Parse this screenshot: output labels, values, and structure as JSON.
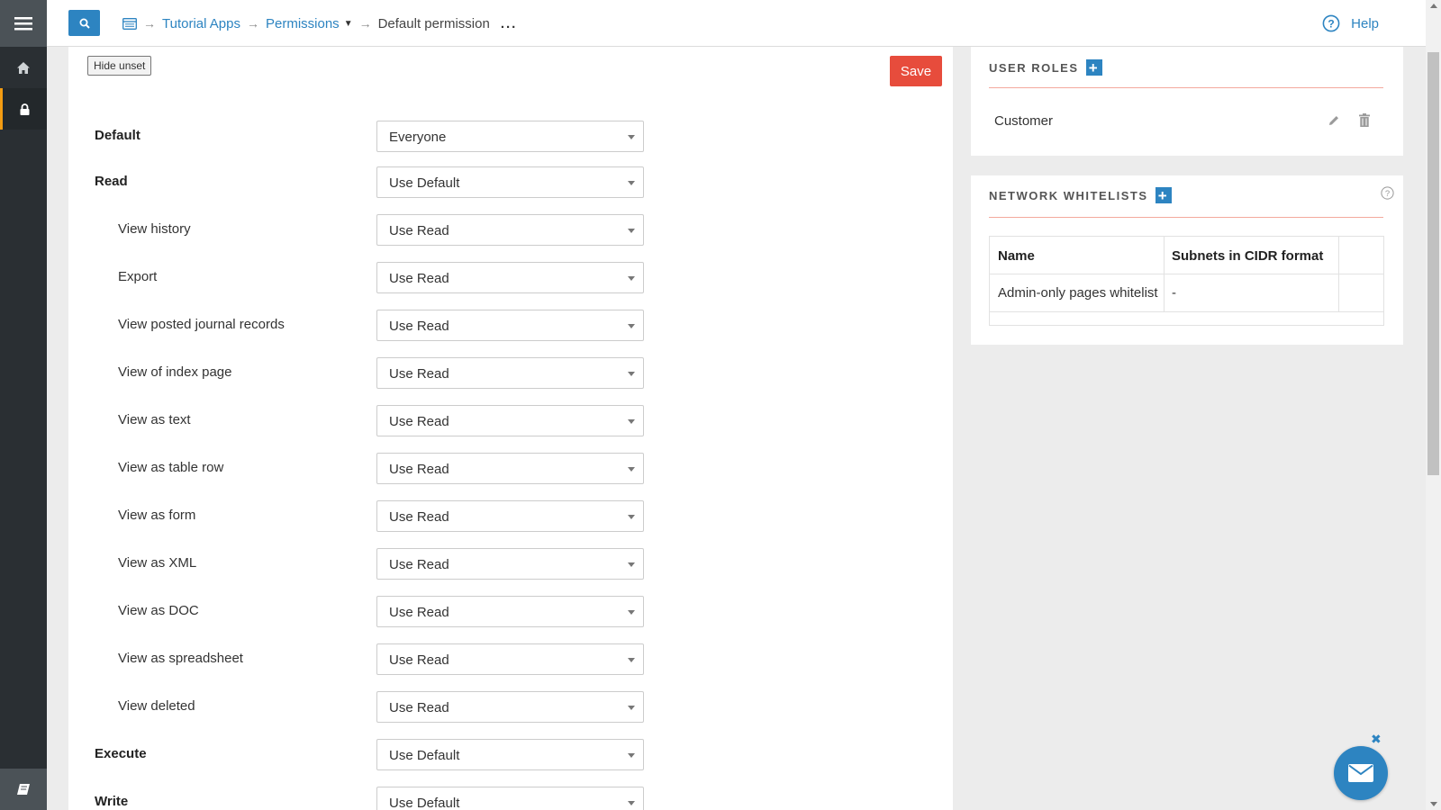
{
  "topbar": {
    "breadcrumb": {
      "crumb1": "Tutorial Apps",
      "crumb2": "Permissions",
      "crumb3": "Default permission",
      "more": "..."
    },
    "help_label": "Help"
  },
  "main": {
    "hide_unset_label": "Hide unset",
    "save_label": "Save",
    "permissions": [
      {
        "label": "Default",
        "value": "Everyone"
      },
      {
        "label": "Read",
        "value": "Use Default"
      },
      {
        "label": "View history",
        "value": "Use Read"
      },
      {
        "label": "Export",
        "value": "Use Read"
      },
      {
        "label": "View posted journal records",
        "value": "Use Read"
      },
      {
        "label": "View of index page",
        "value": "Use Read"
      },
      {
        "label": "View as text",
        "value": "Use Read"
      },
      {
        "label": "View as table row",
        "value": "Use Read"
      },
      {
        "label": "View as form",
        "value": "Use Read"
      },
      {
        "label": "View as XML",
        "value": "Use Read"
      },
      {
        "label": "View as DOC",
        "value": "Use Read"
      },
      {
        "label": "View as spreadsheet",
        "value": "Use Read"
      },
      {
        "label": "View deleted",
        "value": "Use Read"
      },
      {
        "label": "Execute",
        "value": "Use Default"
      },
      {
        "label": "Write",
        "value": "Use Default"
      }
    ]
  },
  "user_roles": {
    "title": "USER ROLES",
    "roles": [
      "Customer"
    ]
  },
  "network_whitelists": {
    "title": "NETWORK WHITELISTS",
    "columns": [
      "Name",
      "Subnets in CIDR format"
    ],
    "rows": [
      {
        "name": "Admin-only pages whitelist",
        "subnets": "-"
      }
    ]
  },
  "colors": {
    "accent": "#2d84c1",
    "danger": "#e74c3c",
    "sidebar_bg": "#2a2f33",
    "active_marker": "#f39c12"
  },
  "icons": {
    "sidebar": [
      "menu-icon",
      "home-icon",
      "lock-icon",
      "book-icon"
    ],
    "topbar": [
      "search-icon",
      "window-icon",
      "help-icon"
    ],
    "roles": [
      "plus-icon",
      "pencil-icon",
      "trash-icon"
    ],
    "chat": [
      "close-icon",
      "envelope-icon"
    ]
  }
}
